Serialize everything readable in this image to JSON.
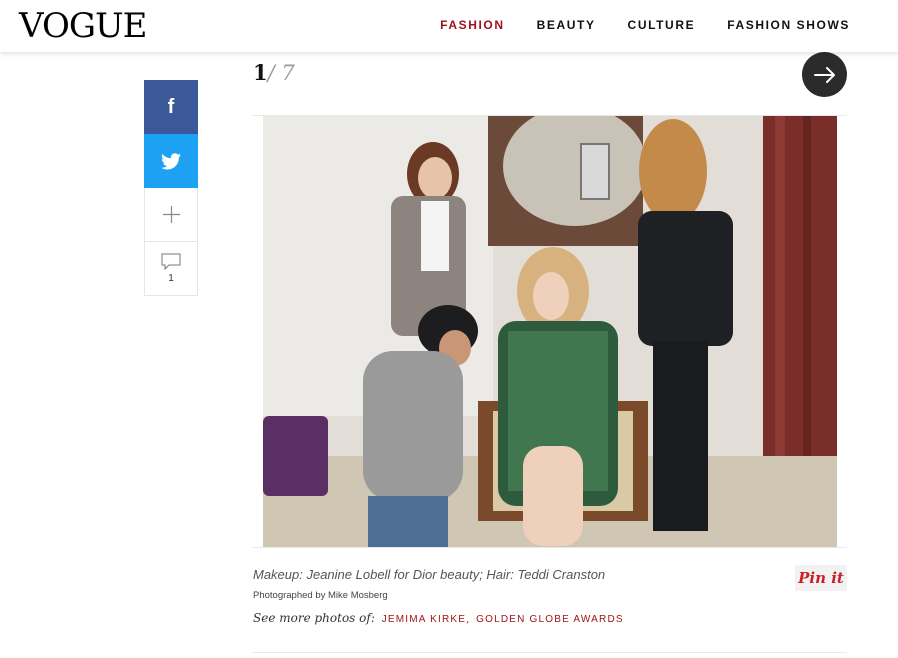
{
  "brand": {
    "logo": "VOGUE"
  },
  "nav": {
    "items": [
      {
        "label": "FASHION",
        "active": true
      },
      {
        "label": "BEAUTY",
        "active": false
      },
      {
        "label": "CULTURE",
        "active": false
      },
      {
        "label": "FASHION SHOWS",
        "active": false
      }
    ]
  },
  "share": {
    "facebook_glyph": "f",
    "comment_count": "1"
  },
  "gallery": {
    "current": "1",
    "separator": "/",
    "total": "7"
  },
  "caption": {
    "text": "Makeup: Jeanine Lobell for Dior beauty; Hair: Teddi Cranston",
    "credit": "Photographed by Mike Mosberg",
    "more_label": "See more photos of:",
    "tags": [
      "JEMIMA KIRKE",
      "GOLDEN GLOBE AWARDS"
    ],
    "tag_separator": ","
  },
  "pin": {
    "label": "Pin it"
  },
  "colors": {
    "accent": "#a0131b",
    "facebook": "#3b5998",
    "twitter": "#1da1f2",
    "pinterest": "#cb2027"
  }
}
